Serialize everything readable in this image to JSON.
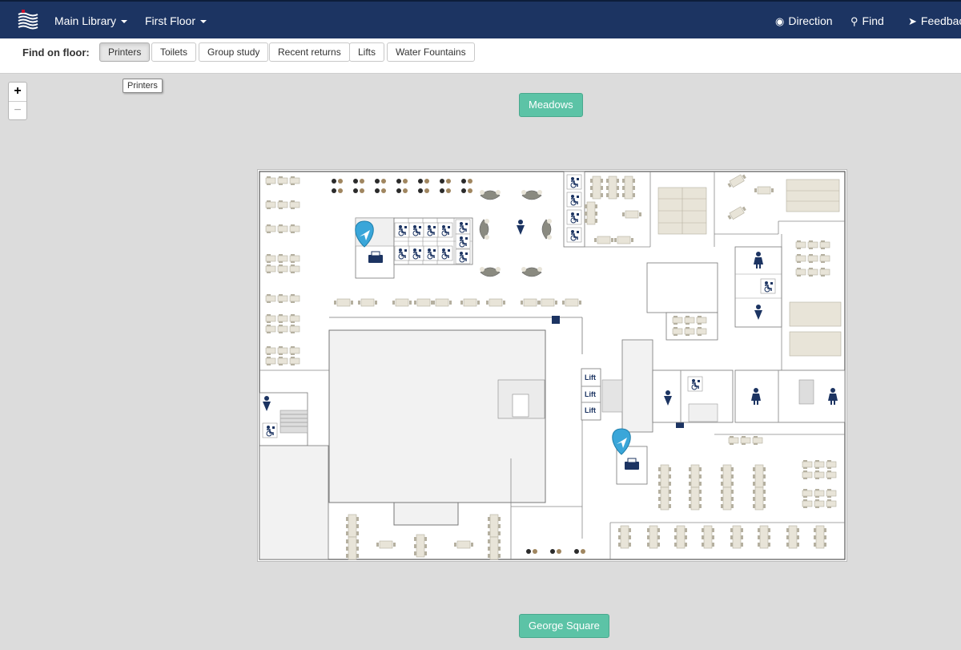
{
  "header": {
    "library_label": "Main Library",
    "floor_label": "First Floor",
    "direction_label": "Direction",
    "find_label": "Find",
    "feedback_label": "Feedback"
  },
  "filters": {
    "label": "Find on floor:",
    "buttons": [
      "Printers",
      "Toilets",
      "Group study",
      "Recent returns",
      "Lifts",
      "Water Fountains"
    ],
    "active": "Printers"
  },
  "tooltip": "Printers",
  "zoom": {
    "in": "+",
    "out": "−"
  },
  "streets": {
    "north": "Meadows",
    "south": "George Square"
  },
  "map": {
    "lift_label": "Lift",
    "markers": [
      "printer-marker-west",
      "printer-marker-east"
    ]
  },
  "colors": {
    "navbar": "#1c3462",
    "street_button": "#5cc3a6",
    "marker": "#3aa6d9",
    "icon_navy": "#1c3462",
    "furniture": "#e8e4d8"
  }
}
